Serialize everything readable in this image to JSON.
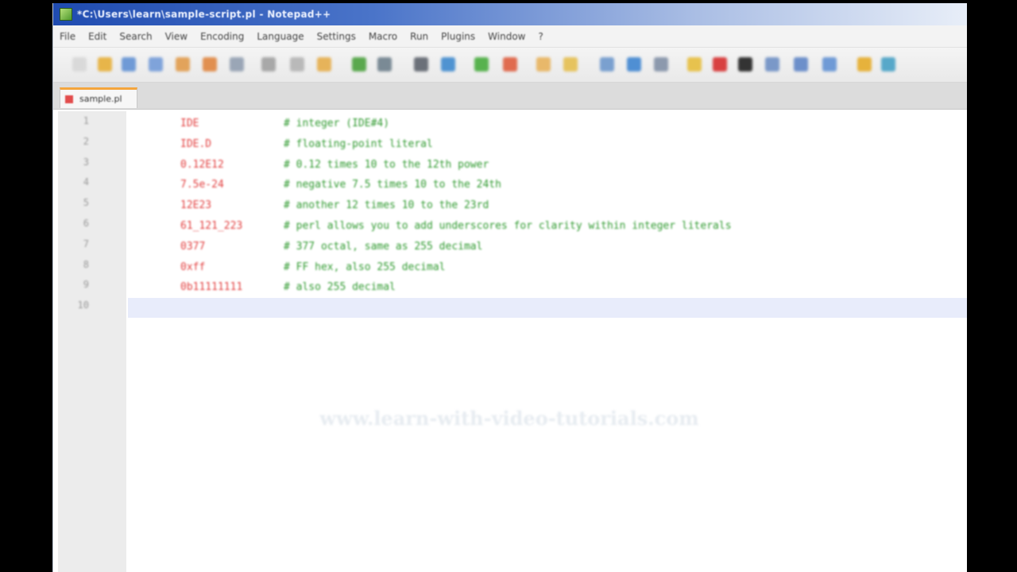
{
  "window": {
    "title": "*C:\\Users\\learn\\sample-script.pl - Notepad++"
  },
  "menu": [
    "File",
    "Edit",
    "Search",
    "View",
    "Encoding",
    "Language",
    "Settings",
    "Macro",
    "Run",
    "Plugins",
    "Window",
    "?"
  ],
  "toolbar_icons": [
    {
      "name": "new-file-icon",
      "color": "#d9d9d9"
    },
    {
      "name": "open-file-icon",
      "color": "#e7b54a"
    },
    {
      "name": "save-icon",
      "color": "#6f9ad6"
    },
    {
      "name": "save-all-icon",
      "color": "#7fa3da"
    },
    {
      "name": "close-icon",
      "color": "#e2a35b"
    },
    {
      "name": "close-all-icon",
      "color": "#e18f4f"
    },
    {
      "name": "print-icon",
      "color": "#9aa6b6"
    },
    {
      "name": "cut-icon",
      "color": "#a8a8a8"
    },
    {
      "name": "copy-icon",
      "color": "#b9b9b9"
    },
    {
      "name": "paste-icon",
      "color": "#e6b35a"
    },
    {
      "name": "undo-icon",
      "color": "#5aa84e"
    },
    {
      "name": "redo-icon",
      "color": "#7a8a95"
    },
    {
      "name": "find-icon",
      "color": "#6b7079"
    },
    {
      "name": "replace-icon",
      "color": "#4f93d1"
    },
    {
      "name": "zoom-in-icon",
      "color": "#57b24e"
    },
    {
      "name": "zoom-out-icon",
      "color": "#e06b4f"
    },
    {
      "name": "sync-v-icon",
      "color": "#e8b86a"
    },
    {
      "name": "sync-h-icon",
      "color": "#e6c35e"
    },
    {
      "name": "word-wrap-icon",
      "color": "#7aa0cf"
    },
    {
      "name": "all-chars-icon",
      "color": "#4f8fd3"
    },
    {
      "name": "indent-guide-icon",
      "color": "#8c99ad"
    },
    {
      "name": "user-lang-icon",
      "color": "#e7c24e"
    },
    {
      "name": "record-macro-icon",
      "color": "#d84040"
    },
    {
      "name": "stop-macro-icon",
      "color": "#333333"
    },
    {
      "name": "play-macro-icon",
      "color": "#7a98c8"
    },
    {
      "name": "play-multi-icon",
      "color": "#6c8fca"
    },
    {
      "name": "save-macro-icon",
      "color": "#6f9ad6"
    },
    {
      "name": "run-icon",
      "color": "#e6b23c"
    },
    {
      "name": "plugin-icon",
      "color": "#57a8c9"
    }
  ],
  "tab": {
    "label": "sample.pl"
  },
  "code_lines": [
    {
      "num": "1",
      "cmd": "IDE",
      "comment": "# integer (IDE#4)"
    },
    {
      "num": "2",
      "cmd": "IDE.D",
      "comment": "# floating-point literal"
    },
    {
      "num": "3",
      "cmd": "0.12E12",
      "comment": "# 0.12 times 10 to the 12th power"
    },
    {
      "num": "4",
      "cmd": "7.5e-24",
      "comment": "# negative 7.5 times 10 to the 24th"
    },
    {
      "num": "5",
      "cmd": "12E23",
      "comment": "# another 12 times 10 to the 23rd"
    },
    {
      "num": "6",
      "cmd": "61_121_223",
      "comment": "# perl allows you to add underscores for clarity within integer literals"
    },
    {
      "num": "7",
      "cmd": "0377",
      "comment": "# 377 octal, same as 255 decimal"
    },
    {
      "num": "8",
      "cmd": "0xff",
      "comment": "# FF hex, also 255 decimal"
    },
    {
      "num": "9",
      "cmd": "0b11111111",
      "comment": "# also 255 decimal"
    },
    {
      "num": "10",
      "cmd": "",
      "comment": ""
    }
  ],
  "watermark": "www.learn-with-video-tutorials.com"
}
